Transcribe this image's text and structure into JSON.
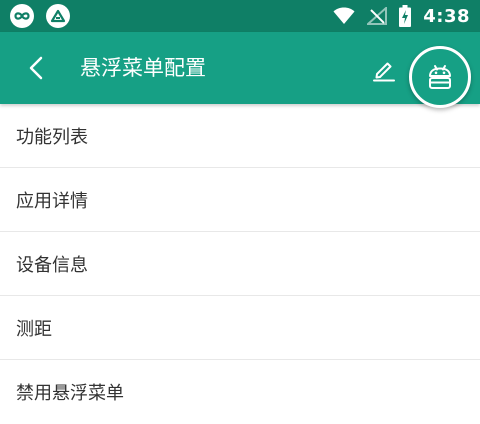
{
  "status_bar": {
    "time": "4:38",
    "background": "#0f7f66"
  },
  "app_bar": {
    "title": "悬浮菜单配置",
    "background": "#16a085"
  },
  "menu": {
    "items": [
      {
        "label": "功能列表"
      },
      {
        "label": "应用详情"
      },
      {
        "label": "设备信息"
      },
      {
        "label": "测距"
      },
      {
        "label": "禁用悬浮菜单"
      }
    ]
  }
}
